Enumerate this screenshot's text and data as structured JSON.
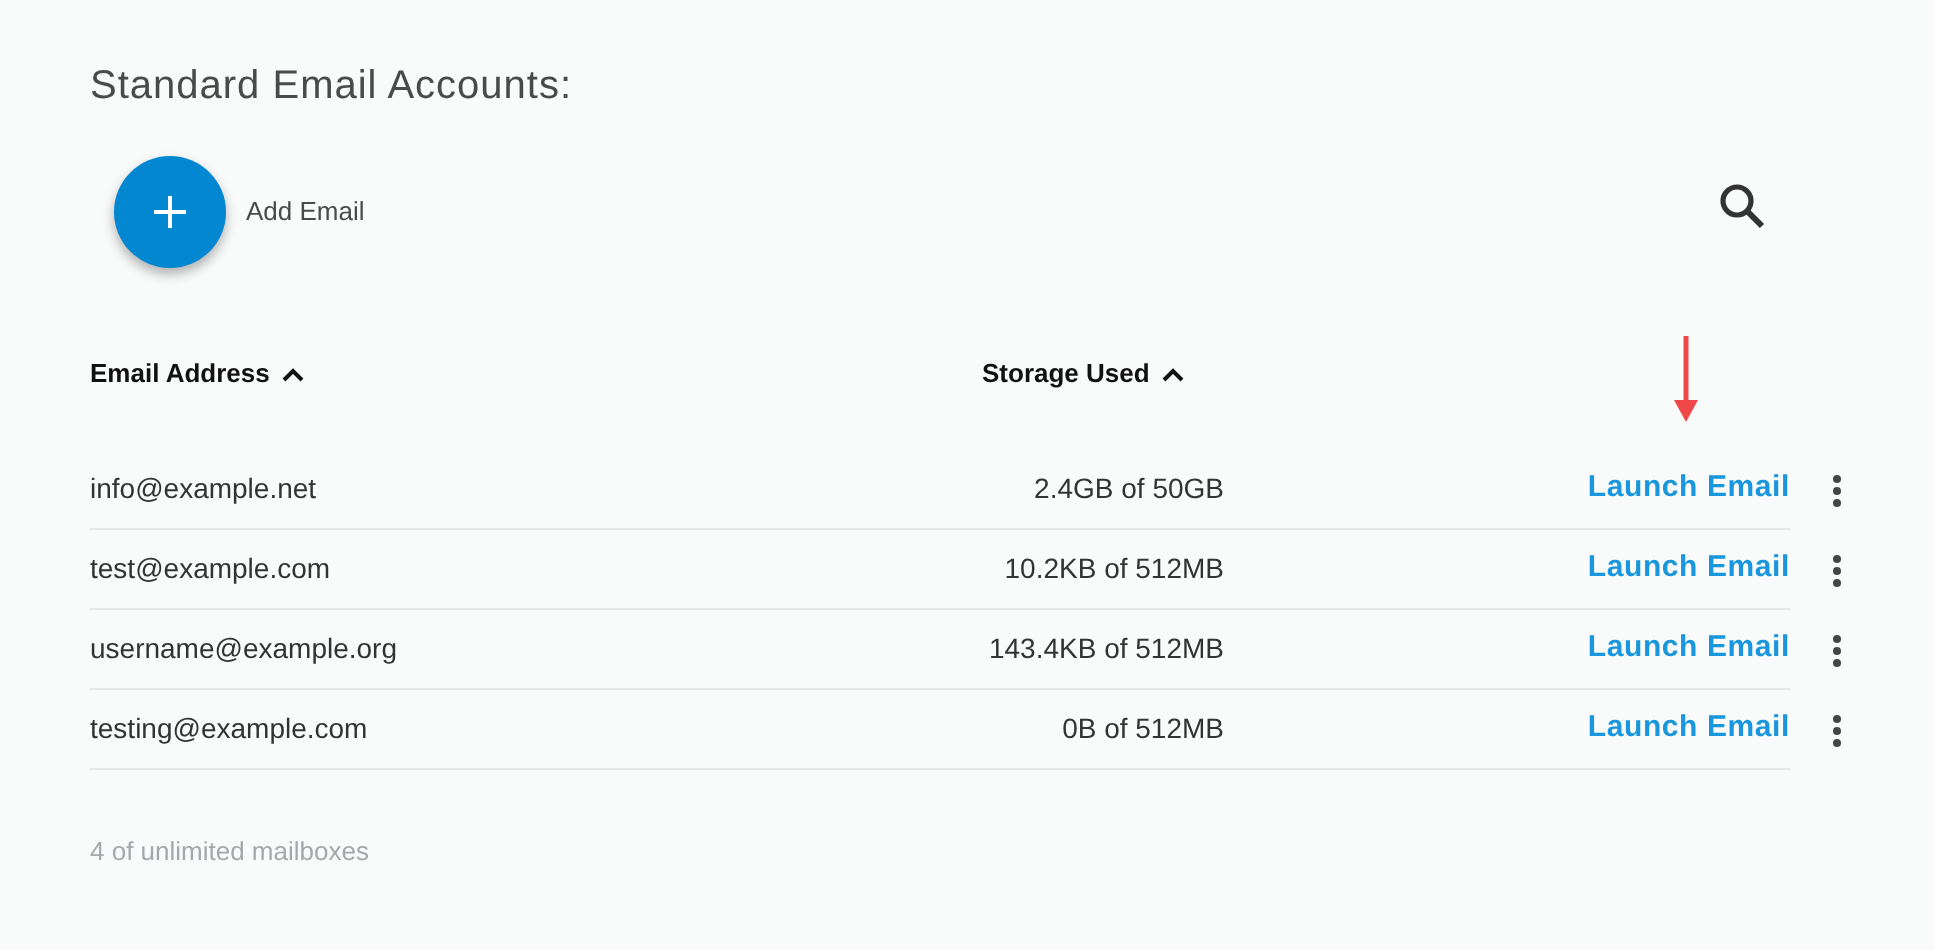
{
  "title": "Standard Email Accounts:",
  "add_button": {
    "label": "Add Email"
  },
  "table": {
    "columns": [
      {
        "label": "Email Address",
        "ascending": true
      },
      {
        "label": "Storage Used",
        "ascending": true
      }
    ],
    "rows": [
      {
        "email": "info@example.net",
        "storage": "2.4GB of 50GB",
        "action": "Launch Email",
        "highlighted": true
      },
      {
        "email": "test@example.com",
        "storage": "10.2KB of 512MB",
        "action": "Launch Email",
        "highlighted": false
      },
      {
        "email": "username@example.org",
        "storage": "143.4KB of 512MB",
        "action": "Launch Email",
        "highlighted": false
      },
      {
        "email": "testing@example.com",
        "storage": "0B of 512MB",
        "action": "Launch Email",
        "highlighted": false
      }
    ]
  },
  "footer": "4 of unlimited mailboxes"
}
